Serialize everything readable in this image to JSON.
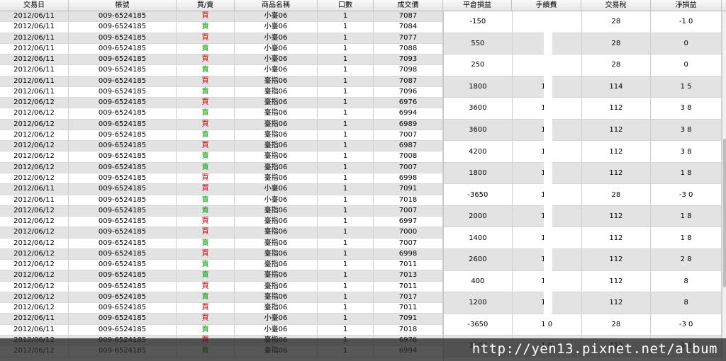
{
  "left_headers": [
    "交易日",
    "帳號",
    "買/賣",
    "商品名稱",
    "口數",
    "成交價"
  ],
  "right_headers": [
    "平倉損益",
    "手續費",
    "交易稅",
    "淨損益"
  ],
  "left_rows": [
    {
      "date": "2012/06/11",
      "account": "009-6524185",
      "side": "買",
      "product": "小臺06",
      "qty": "1",
      "price": "7087"
    },
    {
      "date": "2012/06/11",
      "account": "009-6524185",
      "side": "賣",
      "product": "小臺06",
      "qty": "1",
      "price": "7084"
    },
    {
      "date": "2012/06/11",
      "account": "009-6524185",
      "side": "買",
      "product": "小臺06",
      "qty": "1",
      "price": "7077"
    },
    {
      "date": "2012/06/11",
      "account": "009-6524185",
      "side": "賣",
      "product": "小臺06",
      "qty": "1",
      "price": "7088"
    },
    {
      "date": "2012/06/11",
      "account": "009-6524185",
      "side": "買",
      "product": "小臺06",
      "qty": "1",
      "price": "7093"
    },
    {
      "date": "2012/06/11",
      "account": "009-6524185",
      "side": "賣",
      "product": "小臺06",
      "qty": "1",
      "price": "7098"
    },
    {
      "date": "2012/06/11",
      "account": "009-6524185",
      "side": "買",
      "product": "臺指06",
      "qty": "1",
      "price": "7087"
    },
    {
      "date": "2012/06/11",
      "account": "009-6524185",
      "side": "賣",
      "product": "臺指06",
      "qty": "1",
      "price": "7096"
    },
    {
      "date": "2012/06/12",
      "account": "009-6524185",
      "side": "買",
      "product": "臺指06",
      "qty": "1",
      "price": "6976"
    },
    {
      "date": "2012/06/12",
      "account": "009-6524185",
      "side": "賣",
      "product": "臺指06",
      "qty": "1",
      "price": "6994"
    },
    {
      "date": "2012/06/12",
      "account": "009-6524185",
      "side": "買",
      "product": "臺指06",
      "qty": "1",
      "price": "6989"
    },
    {
      "date": "2012/06/12",
      "account": "009-6524185",
      "side": "賣",
      "product": "臺指06",
      "qty": "1",
      "price": "7007"
    },
    {
      "date": "2012/06/12",
      "account": "009-6524185",
      "side": "買",
      "product": "臺指06",
      "qty": "1",
      "price": "6987"
    },
    {
      "date": "2012/06/12",
      "account": "009-6524185",
      "side": "賣",
      "product": "臺指06",
      "qty": "1",
      "price": "7008"
    },
    {
      "date": "2012/06/12",
      "account": "009-6524185",
      "side": "賣",
      "product": "臺指06",
      "qty": "1",
      "price": "7007"
    },
    {
      "date": "2012/06/12",
      "account": "009-6524185",
      "side": "買",
      "product": "臺指06",
      "qty": "1",
      "price": "6998"
    },
    {
      "date": "2012/06/11",
      "account": "009-6524185",
      "side": "買",
      "product": "小臺06",
      "qty": "1",
      "price": "7091"
    },
    {
      "date": "2012/06/11",
      "account": "009-6524185",
      "side": "賣",
      "product": "小臺06",
      "qty": "1",
      "price": "7018"
    },
    {
      "date": "2012/06/12",
      "account": "009-6524185",
      "side": "賣",
      "product": "臺指06",
      "qty": "1",
      "price": "7007"
    },
    {
      "date": "2012/06/12",
      "account": "009-6524185",
      "side": "買",
      "product": "臺指06",
      "qty": "1",
      "price": "6997"
    },
    {
      "date": "2012/06/12",
      "account": "009-6524185",
      "side": "買",
      "product": "臺指06",
      "qty": "1",
      "price": "7000"
    },
    {
      "date": "2012/06/12",
      "account": "009-6524185",
      "side": "賣",
      "product": "臺指06",
      "qty": "1",
      "price": "7007"
    },
    {
      "date": "2012/06/12",
      "account": "009-6524185",
      "side": "買",
      "product": "臺指06",
      "qty": "1",
      "price": "6998"
    },
    {
      "date": "2012/06/12",
      "account": "009-6524185",
      "side": "賣",
      "product": "臺指06",
      "qty": "1",
      "price": "7011"
    },
    {
      "date": "2012/06/12",
      "account": "009-6524185",
      "side": "賣",
      "product": "臺指06",
      "qty": "1",
      "price": "7013"
    },
    {
      "date": "2012/06/12",
      "account": "009-6524185",
      "side": "買",
      "product": "臺指06",
      "qty": "1",
      "price": "7011"
    },
    {
      "date": "2012/06/12",
      "account": "009-6524185",
      "side": "賣",
      "product": "臺指06",
      "qty": "1",
      "price": "7017"
    },
    {
      "date": "2012/06/12",
      "account": "009-6524185",
      "side": "買",
      "product": "臺指06",
      "qty": "1",
      "price": "7011"
    },
    {
      "date": "2012/06/11",
      "account": "009-6524185",
      "side": "買",
      "product": "小臺06",
      "qty": "1",
      "price": "7091"
    },
    {
      "date": "2012/06/11",
      "account": "009-6524185",
      "side": "賣",
      "product": "小臺06",
      "qty": "1",
      "price": "7018"
    },
    {
      "date": "2012/06/12",
      "account": "009-6524185",
      "side": "買",
      "product": "臺指06",
      "qty": "1",
      "price": "6976"
    },
    {
      "date": "2012/06/12",
      "account": "009-6524185",
      "side": "賣",
      "product": "臺指06",
      "qty": "1",
      "price": "6994"
    }
  ],
  "right_rows": [
    {
      "pnl": "-150",
      "fee": "",
      "tax": "28",
      "net": "-1  0"
    },
    {
      "pnl": "550",
      "fee": "",
      "tax": "28",
      "net": "  0"
    },
    {
      "pnl": "250",
      "fee": "",
      "tax": "28",
      "net": "  0"
    },
    {
      "pnl": "1800",
      "fee": "1  0",
      "tax": "114",
      "net": "1  5"
    },
    {
      "pnl": "3600",
      "fee": "1  0",
      "tax": "112",
      "net": "3  8"
    },
    {
      "pnl": "3600",
      "fee": "1  0",
      "tax": "112",
      "net": "3  8"
    },
    {
      "pnl": "4200",
      "fee": "1  0",
      "tax": "112",
      "net": "3  8"
    },
    {
      "pnl": "1800",
      "fee": "1  0",
      "tax": "112",
      "net": "1  8"
    },
    {
      "pnl": "-3650",
      "fee": "1  0",
      "tax": "28",
      "net": "-3  0"
    },
    {
      "pnl": "2000",
      "fee": "1  0",
      "tax": "112",
      "net": "1  8"
    },
    {
      "pnl": "1400",
      "fee": "1  0",
      "tax": "112",
      "net": "1  8"
    },
    {
      "pnl": "2600",
      "fee": "1  0",
      "tax": "112",
      "net": "2  8"
    },
    {
      "pnl": "400",
      "fee": "1  0",
      "tax": "112",
      "net": "  8"
    },
    {
      "pnl": "1200",
      "fee": "1  0",
      "tax": "112",
      "net": "  8"
    },
    {
      "pnl": "-3650",
      "fee": "1  0",
      "tax": "28",
      "net": "-3  0"
    },
    {
      "pnl": "3500",
      "fee": "1  0",
      "tax": "112",
      "net": "3  8"
    }
  ],
  "watermark": "http://yen13.pixnet.net/album",
  "colors": {
    "buy": "#d40000",
    "sell": "#00a000",
    "row_alt": "#e3e3e3"
  }
}
